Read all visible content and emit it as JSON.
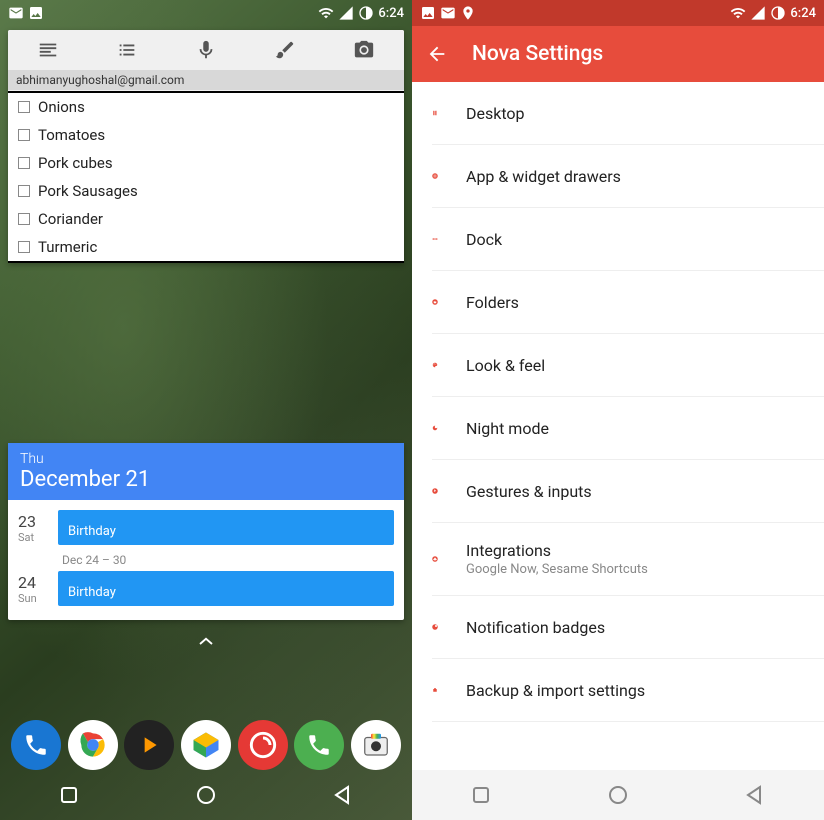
{
  "left": {
    "status": {
      "time": "6:24"
    },
    "notes": {
      "email": "abhimanyughoshal@gmail.com",
      "items": [
        "Onions",
        "Tomatoes",
        "Pork cubes",
        "Pork Sausages",
        "Coriander",
        "Turmeric"
      ]
    },
    "calendar": {
      "dow": "Thu",
      "date": "December 21",
      "events": [
        {
          "daynum": "23",
          "dayname": "Sat",
          "title": "Birthday"
        }
      ],
      "range": "Dec 24 – 30",
      "events2": [
        {
          "daynum": "24",
          "dayname": "Sun",
          "title": "Birthday"
        }
      ]
    },
    "dock_icons": [
      "phone",
      "chrome",
      "play-music",
      "files",
      "pocket-casts",
      "whatsapp",
      "camera"
    ]
  },
  "right": {
    "status": {
      "time": "6:24"
    },
    "title": "Nova Settings",
    "items": [
      {
        "icon": "desktop",
        "label": "Desktop",
        "sub": ""
      },
      {
        "icon": "grid",
        "label": "App & widget drawers",
        "sub": ""
      },
      {
        "icon": "dock",
        "label": "Dock",
        "sub": ""
      },
      {
        "icon": "folder",
        "label": "Folders",
        "sub": ""
      },
      {
        "icon": "palette",
        "label": "Look & feel",
        "sub": ""
      },
      {
        "icon": "moon",
        "label": "Night mode",
        "sub": ""
      },
      {
        "icon": "gesture",
        "label": "Gestures & inputs",
        "sub": ""
      },
      {
        "icon": "plugin",
        "label": "Integrations",
        "sub": "Google Now, Sesame Shortcuts"
      },
      {
        "icon": "badge",
        "label": "Notification badges",
        "sub": ""
      },
      {
        "icon": "backup",
        "label": "Backup & import settings",
        "sub": ""
      }
    ]
  }
}
